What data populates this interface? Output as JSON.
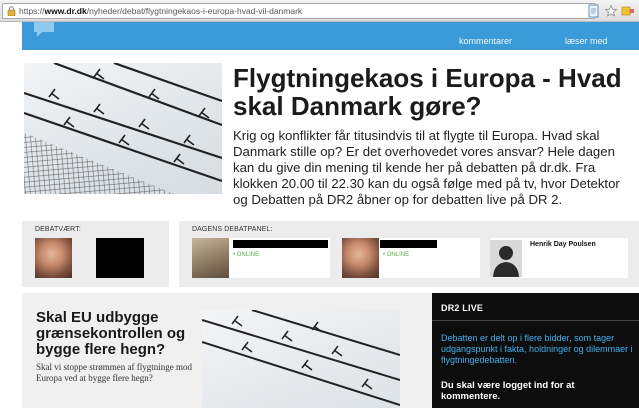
{
  "browser": {
    "url_prefix": "https://",
    "url_host": "www.dr.dk",
    "url_path": "/nyheder/debat/flygtningekaos-i-europa-hvad-vil-danmark"
  },
  "topstrip": {
    "comments_label": "kommentarer",
    "readers_label": "læser med"
  },
  "hero": {
    "title": "Flygtningekaos i Europa - Hvad skal Danmark gøre?",
    "body": "Krig og konflikter får titusindvis til at flygte til Europa. Hvad skal Danmark stille op? Er det overhovedet vores ansvar? Hele dagen kan du give din mening til kende her på debatten på dr.dk. Fra klokken 20.00 til 22.30 kan du også følge med på tv, hvor Detektor og Debatten på DR2 åbner op for debatten live på DR 2."
  },
  "host_panel": {
    "label": "DEBATVÆRT:"
  },
  "debate_panel": {
    "label": "DAGENS DEBATPANEL:",
    "members": [
      {
        "status": "• ONLINE"
      },
      {
        "status": "• ONLINE"
      },
      {
        "name": "Henrik Day Poulsen"
      }
    ]
  },
  "article": {
    "title": "Skal EU udbygge grænsekontrollen og bygge flere hegn?",
    "teaser": "Skal vi stoppe strømmen af flygtninge mod Europa ved at bygge flere hegn?"
  },
  "live": {
    "title": "DR2 LIVE",
    "description": "Debatten er delt op i flere bidder, som tager udgangspunkt i fakta, holdninger og dilemmaer i flygtningedebatten.",
    "login_notice": "Du skal være logget ind for at kommentere."
  },
  "colors": {
    "accent_blue": "#3a9bd8",
    "online_green": "#58b04a",
    "live_link_blue": "#43b0ee"
  }
}
